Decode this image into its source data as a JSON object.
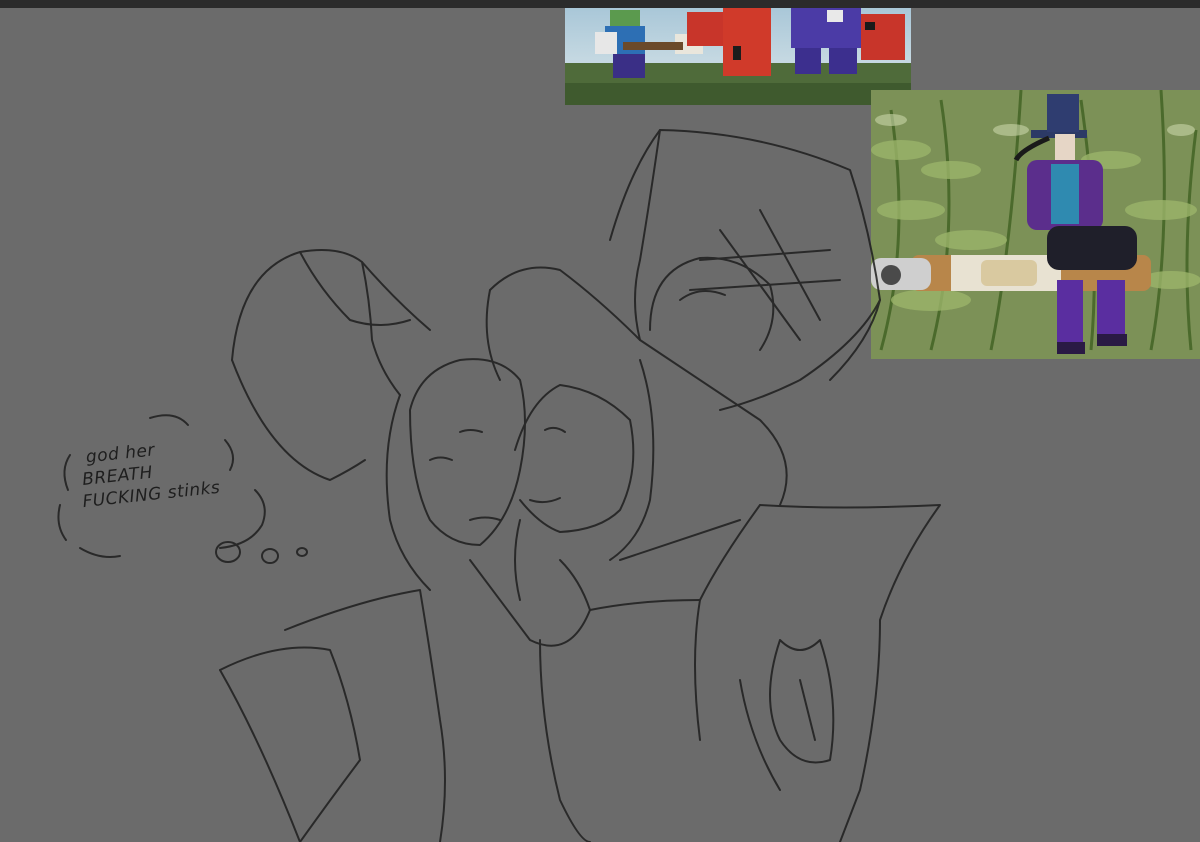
{
  "speech_bubble": {
    "line1": "god her",
    "line2": "BREATH",
    "line3": "FUCKING stinks"
  },
  "reference_images": {
    "top": {
      "subject": "blocky-game-characters-screenshot"
    },
    "right": {
      "subject": "character-on-cigar-in-ferns"
    }
  },
  "colors": {
    "canvas": "#6b6b6b",
    "topbar": "#2b2b2b",
    "pencil": "#1e1e1e"
  }
}
